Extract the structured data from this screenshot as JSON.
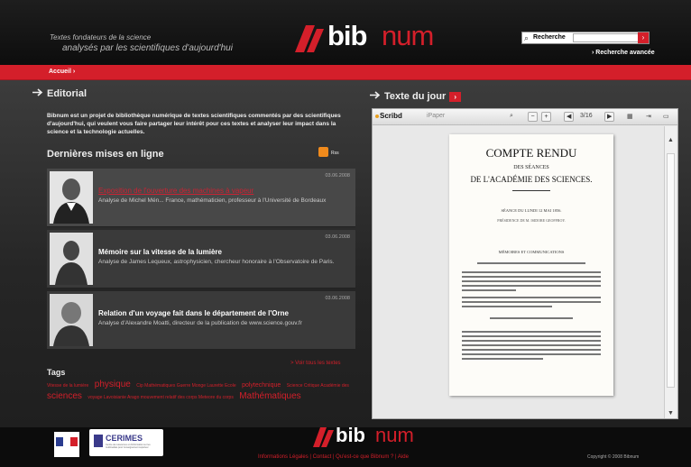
{
  "header": {
    "tagline_line1": "Textes fondateurs de la science",
    "tagline_line2": "analysés par les scientifiques d'aujourd'hui",
    "logo_bib": "bib",
    "logo_num": "num",
    "search_label": "Recherche",
    "search_go": "›",
    "search_value": "",
    "advanced_search": "› Recherche avancée"
  },
  "nav": {
    "home": "Accueil ›"
  },
  "editorial": {
    "title": "Editorial",
    "text": "Bibnum est un projet de bibliothèque numérique de textes scientifiques commentés par des scientifiques d'aujourd'hui, qui veulent vous faire partager leur intérêt pour ces textes et analyser leur impact dans la science et la technologie actuelles."
  },
  "latest": {
    "title": "Dernières mises en ligne",
    "rss_label": "Rss",
    "items": [
      {
        "date": "03.06.2008",
        "title": "Exposition de l'ouverture des machines à vapeur",
        "desc": "Analyse de Michel Mén... France, mathématicien, professeur à l'Université de Bordeaux"
      },
      {
        "date": "03.06.2008",
        "title": "Mémoire sur la vitesse de la lumière",
        "desc": "Analyse de James Lequeux, astrophysicien, chercheur honoraire à l'Observatoire de Paris."
      },
      {
        "date": "03.06.2008",
        "title": "Relation d'un voyage fait dans le département de l'Orne",
        "desc": "Analyse d'Alexandre Moatti, directeur de la publication de www.science.gouv.fr"
      }
    ],
    "all_texts": "> Voir tous les textes"
  },
  "tags": {
    "title": "Tags",
    "list": [
      {
        "text": "Vitesse de la lumière",
        "size": "sm"
      },
      {
        "text": "physique",
        "size": "lg"
      },
      {
        "text": "Cip Mathématiques Guerre Monge Laurette Ecole",
        "size": "sm"
      },
      {
        "text": "polytechnique",
        "size": "md"
      },
      {
        "text": "Science Critique Académie des",
        "size": "sm"
      },
      {
        "text": "sciences",
        "size": "lg"
      },
      {
        "text": "voyage Lavoisianie Arago mouvement relatif des corps Meteore du corps",
        "size": "sm"
      },
      {
        "text": "Mathématiques",
        "size": "lg"
      }
    ]
  },
  "texte_du_jour": {
    "title": "Texte du jour",
    "button": "›",
    "viewer": {
      "brand": "Scribd",
      "mode": "iPaper",
      "zoom_out": "−",
      "zoom_in": "+",
      "prev": "◀",
      "page": "3/16",
      "next": "▶",
      "grid": "▦",
      "arrow": "⇥",
      "close": "▭",
      "doc": {
        "heading": "COMPTE RENDU",
        "sub": "DES SÉANCES",
        "heading2": "DE L'ACADÉMIE DES SCIENCES.",
        "session": "SÉANCE DU LUNDI 12 MAI 1856.",
        "president": "PRÉSIDENCE DE M. ISIDORE GEOFFROY.",
        "section": "MÉMOIRES ET COMMUNICATIONS"
      }
    }
  },
  "footer": {
    "logo_bib": "bib",
    "logo_num": "num",
    "cerimes": "CERIMES",
    "cerimes_sub": "Centre de ressources et d'information sur les multimédias pour l'enseignement supérieur",
    "links": "Informations Légales  |  Contact  |  Qu'est-ce que Bibnum ?  |  Aide",
    "copyright": "Copyright © 2008 Bibnum"
  },
  "colors": {
    "accent": "#d41f2a",
    "background": "#1a1a1a"
  }
}
